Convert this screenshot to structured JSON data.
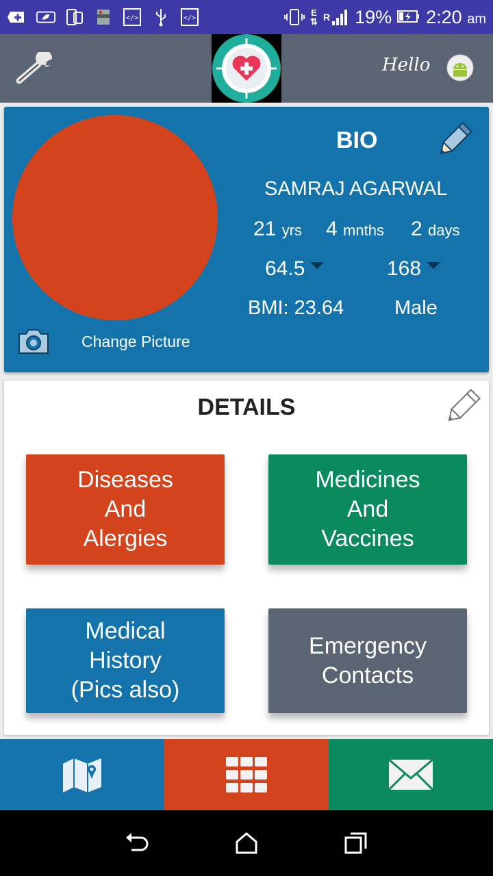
{
  "status_bar": {
    "icons": [
      "add-icon",
      "leaf-icon",
      "phone-copy-icon",
      "archive-icon",
      "code-icon",
      "usb-icon",
      "code-icon",
      "vibrate-icon",
      "data-arrows-icon",
      "signal-icon"
    ],
    "network_e": "E",
    "network_r": "R",
    "battery": "19%",
    "time": "2:20",
    "ampm": "am"
  },
  "app_bar": {
    "hello": "Hello",
    "settings_icon": "wrench-icon",
    "logo_icon": "heart-plus-logo",
    "avatar_icon": "android-avatar"
  },
  "bio": {
    "title": "BIO",
    "name": "SAMRAJ AGARWAL",
    "age_years": "21",
    "age_years_unit": "yrs",
    "age_months": "4",
    "age_months_unit": "mnths",
    "age_days": "2",
    "age_days_unit": "days",
    "weight": "64.5",
    "height": "168",
    "bmi": "BMI: 23.64",
    "gender": "Male",
    "change_picture": "Change Picture",
    "photo_color": "#d4441c"
  },
  "details": {
    "title": "DETAILS",
    "tiles": [
      {
        "label": "Diseases\nAnd\nAlergies",
        "color": "#d4441c"
      },
      {
        "label": "Medicines\nAnd\nVaccines",
        "color": "#0b8a5e"
      },
      {
        "label": "Medical\nHistory\n(Pics also)",
        "color": "#1573ac"
      },
      {
        "label": "Emergency\nContacts",
        "color": "#5b6473"
      }
    ]
  },
  "bottom_nav": [
    {
      "icon": "map-icon",
      "color": "#1573ac"
    },
    {
      "icon": "grid-icon",
      "color": "#d4441c"
    },
    {
      "icon": "mail-icon",
      "color": "#0b8a5e"
    }
  ],
  "system_nav": [
    "back-icon",
    "home-icon",
    "recents-icon"
  ]
}
